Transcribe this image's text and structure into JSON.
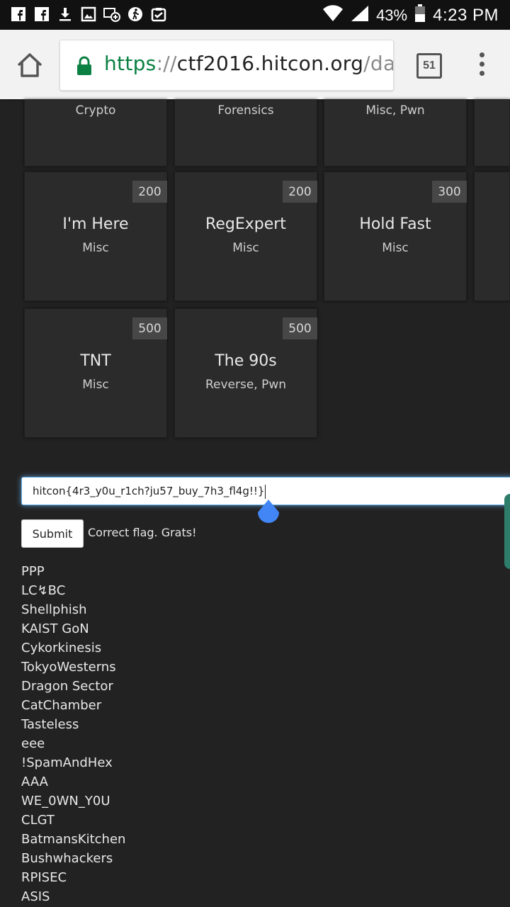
{
  "status_bar": {
    "battery": "43%",
    "time": "4:23 PM",
    "icons": [
      "facebook-icon",
      "facebook-icon",
      "download-icon",
      "image-icon",
      "messenger-icon",
      "fitness-icon",
      "clipboard-check-icon",
      "wifi-icon",
      "signal-icon",
      "battery-icon"
    ]
  },
  "browser": {
    "url_scheme": "https",
    "url_sep": "://",
    "url_host": "ctf2016.hitcon.org",
    "url_path": "/dashb",
    "tab_count": "51"
  },
  "challenges": [
    {
      "title": "",
      "category": "Crypto",
      "points": ""
    },
    {
      "title": "",
      "category": "Forensics",
      "points": ""
    },
    {
      "title": "",
      "category": "Misc, Pwn",
      "points": ""
    },
    {
      "title": "I'm Here",
      "category": "Misc",
      "points": "200"
    },
    {
      "title": "RegExpert",
      "category": "Misc",
      "points": "200"
    },
    {
      "title": "Hold Fast",
      "category": "Misc",
      "points": "300"
    },
    {
      "title": "TNT",
      "category": "Misc",
      "points": "500"
    },
    {
      "title": "The 90s",
      "category": "Reverse, Pwn",
      "points": "500"
    }
  ],
  "flag_form": {
    "value": "hitcon{4r3_y0u_r1ch?ju57_buy_7h3_fl4g!!}",
    "submit_label": "Submit",
    "result": "Correct flag. Grats!"
  },
  "teams": [
    "PPP",
    "LC↯BC",
    "Shellphish",
    "KAIST GoN",
    "Cykorkinesis",
    "TokyoWesterns",
    "Dragon Sector",
    "CatChamber",
    "Tasteless",
    "eee",
    "!SpamAndHex",
    "AAA",
    "WE_0WN_Y0U",
    "CLGT",
    "BatmansKitchen",
    "Bushwhackers",
    "RPISEC",
    "ASIS"
  ],
  "colors": {
    "accent": "#66afe9",
    "secure": "#0b8043",
    "page_bg": "#222222",
    "tile_bg": "#2b2b2b",
    "handle": "#4285f4"
  }
}
